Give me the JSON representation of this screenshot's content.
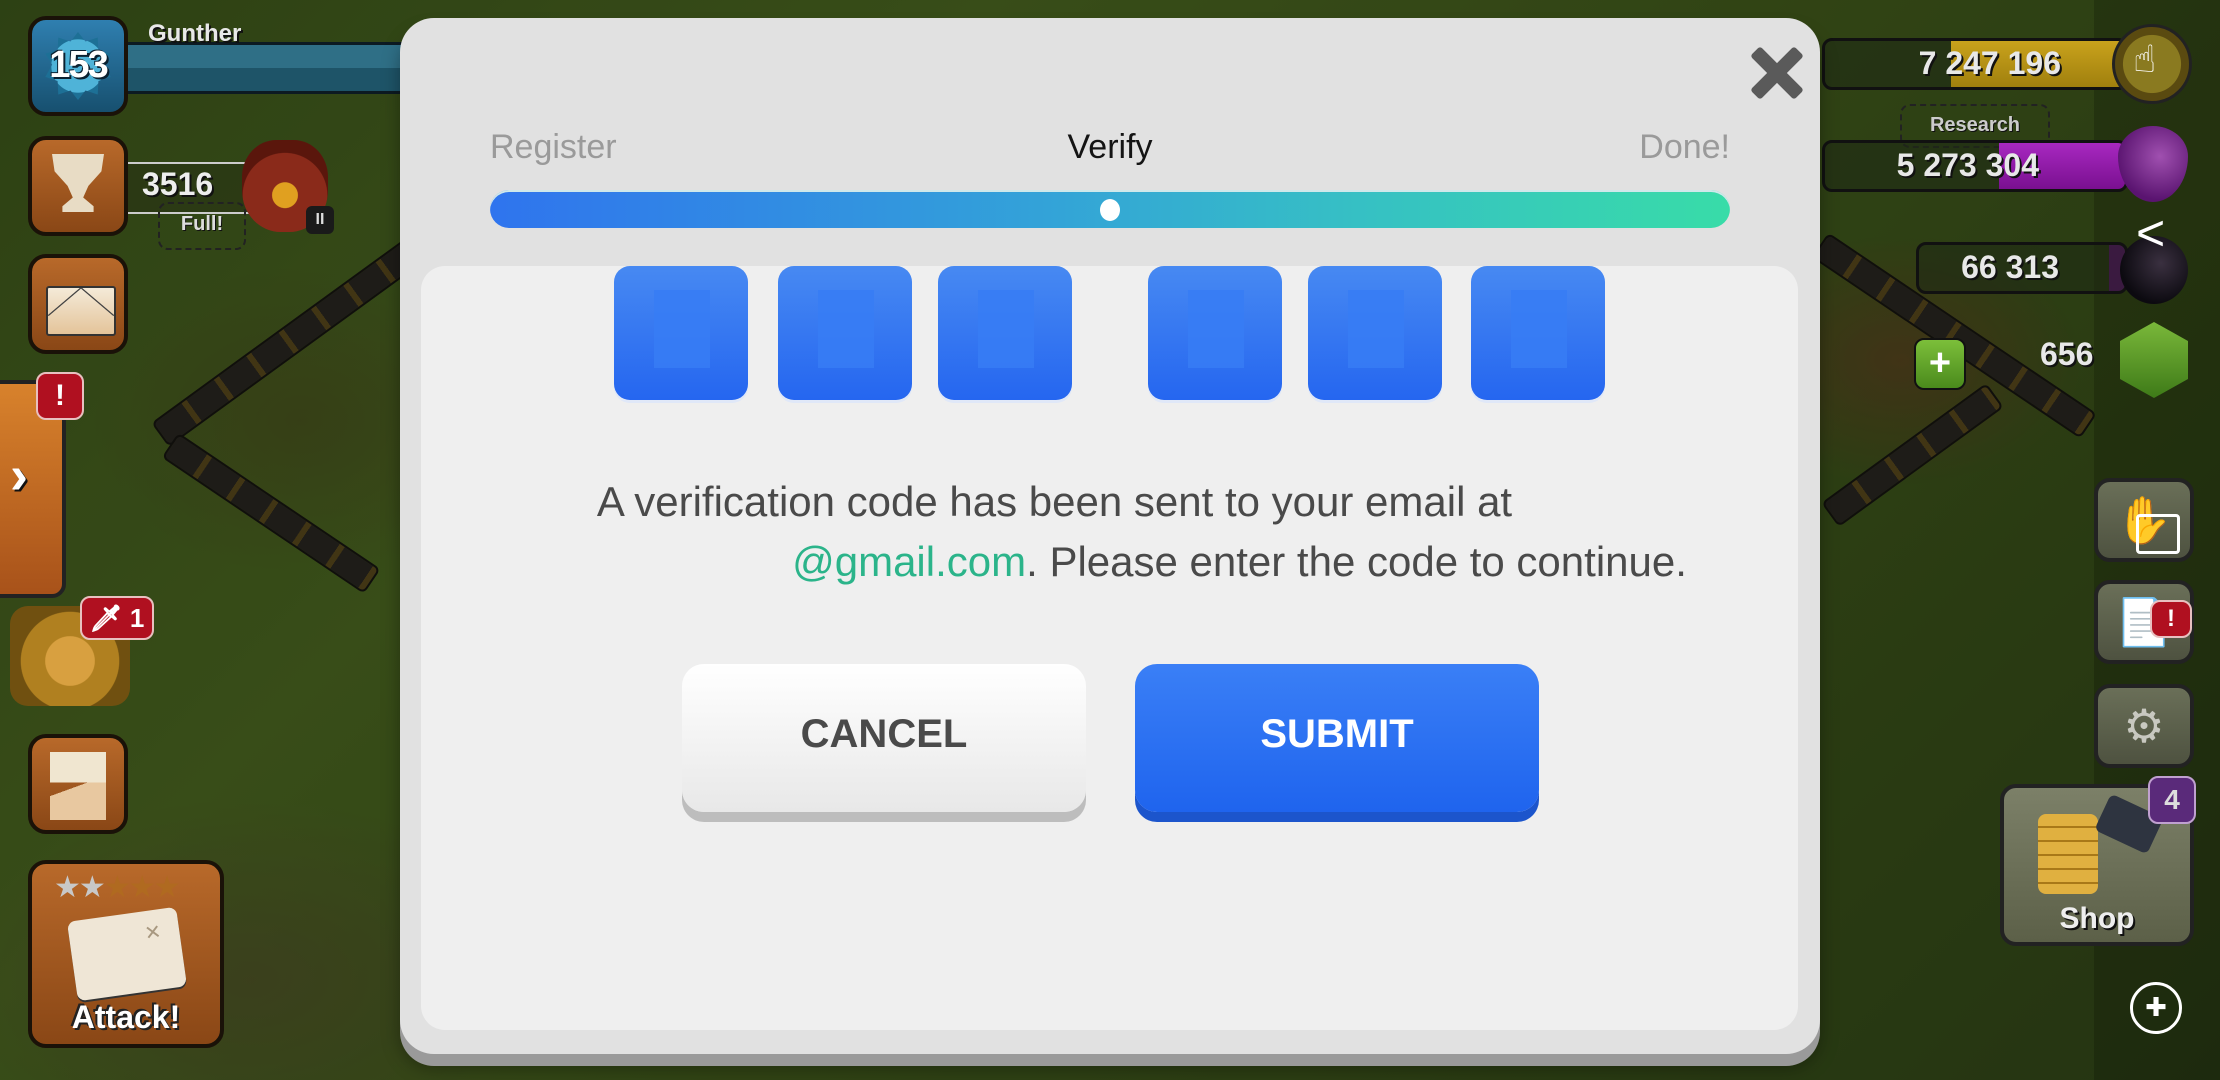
{
  "hud": {
    "player": {
      "name": "Gunther",
      "level": "153"
    },
    "trophies": {
      "count": "3516",
      "status": "Full!"
    },
    "mail_icon": "envelope-icon",
    "alerts": {
      "side_tab_badge": "!",
      "war_badge_count": "1",
      "reports_badge": "!"
    },
    "attack": {
      "label": "Attack!",
      "stars_earned": 2,
      "stars_total": 5,
      "stars_display": "★★★★★"
    },
    "resources": {
      "gold": {
        "value": "7 247 196",
        "fill_fraction": 0.58,
        "color": "#c9a21c"
      },
      "elixir": {
        "value": "5 273 304",
        "fill_fraction": 0.42,
        "color": "#9a1fb0",
        "status": "Research"
      },
      "dark_elixir": {
        "value": "66 313",
        "fill_fraction": 0.08,
        "color": "#3a1a40"
      },
      "gems": {
        "value": "656",
        "add_label": "+"
      }
    },
    "shop": {
      "label": "Shop",
      "badge_count": "4"
    },
    "side_chevron": "›",
    "pause_label": "II"
  },
  "modal": {
    "steps": [
      {
        "label": "Register",
        "state": "inactive"
      },
      {
        "label": "Verify",
        "state": "active"
      },
      {
        "label": "Done!",
        "state": "inactive"
      }
    ],
    "progress_fraction": 0.5,
    "close_icon": "close-icon",
    "code_digits": [
      "",
      "",
      "",
      "",
      "",
      ""
    ],
    "message_line1": "A verification code has been sent to your email at",
    "email_visible": "@gmail.com",
    "message_line2_rest": ". Please enter the code to continue.",
    "cancel_label": "CANCEL",
    "submit_label": "SUBMIT",
    "colors": {
      "accent": "#2566f0",
      "email": "#2bb48a",
      "progress_start": "#2f74ee",
      "progress_end": "#38dca8"
    }
  }
}
